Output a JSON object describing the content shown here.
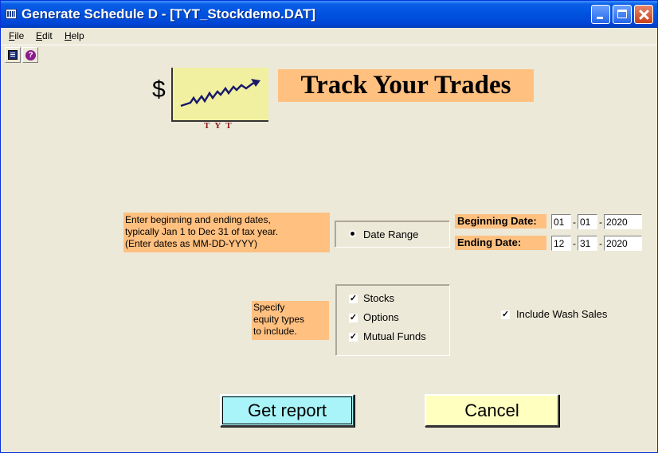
{
  "window": {
    "title": "Generate Schedule D - [TYT_Stockdemo.DAT]"
  },
  "menu": {
    "items": [
      "File",
      "Edit",
      "Help"
    ]
  },
  "toolbar": {
    "icons": [
      "print-icon",
      "help-icon"
    ]
  },
  "logo": {
    "symbol": "$",
    "caption": "TYT"
  },
  "banner": {
    "title": "Track Your Trades"
  },
  "date_section": {
    "instructions": [
      "Enter beginning and ending dates,",
      "typically Jan 1 to Dec 31 of tax year.",
      "(Enter dates as MM-DD-YYYY)"
    ],
    "radio_label": "Date Range",
    "radio_selected": true,
    "beginning_label": "Beginning Date:",
    "beginning": {
      "month": "01",
      "day": "01",
      "year": "2020"
    },
    "ending_label": "Ending Date:",
    "ending": {
      "month": "12",
      "day": "31",
      "year": "2020"
    },
    "separator": "-"
  },
  "equity_section": {
    "instructions": [
      "Specify",
      "equity types",
      "to include."
    ],
    "options": [
      {
        "label": "Stocks",
        "checked": true
      },
      {
        "label": "Options",
        "checked": true
      },
      {
        "label": "Mutual Funds",
        "checked": true
      }
    ]
  },
  "wash_sales": {
    "label": "Include Wash Sales",
    "checked": true
  },
  "buttons": {
    "get_report": "Get report",
    "cancel": "Cancel"
  },
  "colors": {
    "label_bg": "#ffc080",
    "get_report_bg": "#a8f4f8",
    "cancel_bg": "#ffffc0",
    "logo_bg": "#f0f0a0",
    "window_bg": "#ece9d8"
  }
}
